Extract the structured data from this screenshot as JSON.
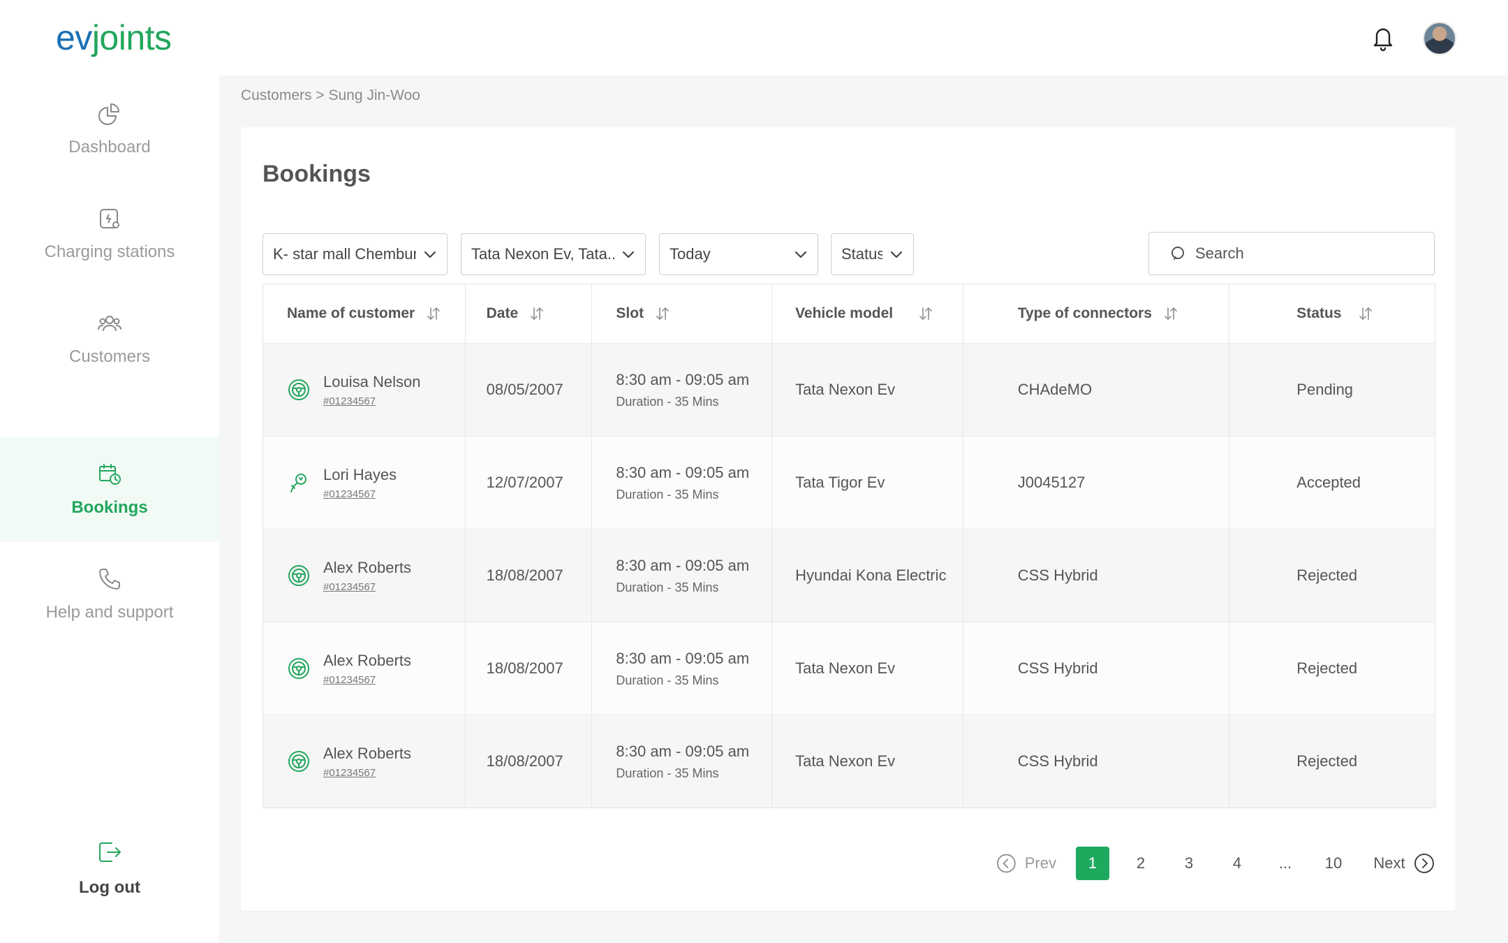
{
  "brand": {
    "part1": "ev",
    "part2": "joints"
  },
  "header": {
    "notification_icon": "bell-icon",
    "avatar": "user-avatar"
  },
  "sidebar": {
    "items": [
      {
        "label": "Dashboard",
        "icon": "pie-chart-icon",
        "active": false
      },
      {
        "label": "Charging stations",
        "icon": "charging-station-icon",
        "active": false
      },
      {
        "label": "Customers",
        "icon": "users-icon",
        "active": false
      },
      {
        "label": "Bookings",
        "icon": "calendar-clock-icon",
        "active": true
      },
      {
        "label": "Help and support",
        "icon": "phone-icon",
        "active": false
      }
    ],
    "logout_label": "Log out"
  },
  "breadcrumb": "Customers > Sung Jin-Woo",
  "page_title": "Bookings",
  "filters": {
    "station": "K- star mall Chembur",
    "vehicle": "Tata Nexon Ev, Tata..",
    "date": "Today",
    "status": "Status"
  },
  "search": {
    "placeholder": "Search",
    "value": ""
  },
  "table": {
    "columns": [
      "Name of customer",
      "Date",
      "Slot",
      "Vehicle model",
      "Type of connectors",
      "Status"
    ],
    "rows": [
      {
        "name": "Louisa Nelson",
        "id": "#01234567",
        "date": "08/05/2007",
        "slot": "8:30 am - 09:05 am",
        "duration": "Duration - 35 Mins",
        "vehicle": "Tata Nexon Ev",
        "connector": "CHAdeMO",
        "status": "Pending"
      },
      {
        "name": "Lori Hayes",
        "id": "#01234567",
        "date": "12/07/2007",
        "slot": "8:30 am - 09:05 am",
        "duration": "Duration - 35 Mins",
        "vehicle": "Tata Tigor Ev",
        "connector": "J0045127",
        "status": "Accepted"
      },
      {
        "name": "Alex Roberts",
        "id": "#01234567",
        "date": "18/08/2007",
        "slot": "8:30 am - 09:05 am",
        "duration": "Duration - 35 Mins",
        "vehicle": "Hyundai Kona Electric",
        "connector": "CSS Hybrid",
        "status": "Rejected"
      },
      {
        "name": "Alex Roberts",
        "id": "#01234567",
        "date": "18/08/2007",
        "slot": "8:30 am - 09:05 am",
        "duration": "Duration - 35 Mins",
        "vehicle": "Tata Nexon Ev",
        "connector": "CSS Hybrid",
        "status": "Rejected"
      },
      {
        "name": "Alex Roberts",
        "id": "#01234567",
        "date": "18/08/2007",
        "slot": "8:30 am - 09:05 am",
        "duration": "Duration - 35 Mins",
        "vehicle": "Tata Nexon Ev",
        "connector": "CSS Hybrid",
        "status": "Rejected"
      }
    ]
  },
  "pagination": {
    "prev_label": "Prev",
    "next_label": "Next",
    "pages": [
      "1",
      "2",
      "3",
      "4",
      "...",
      "10"
    ],
    "current": "1"
  },
  "colors": {
    "accent": "#1fa95e",
    "brand_blue": "#1b6fb4",
    "active_bg": "#f1faf5"
  }
}
